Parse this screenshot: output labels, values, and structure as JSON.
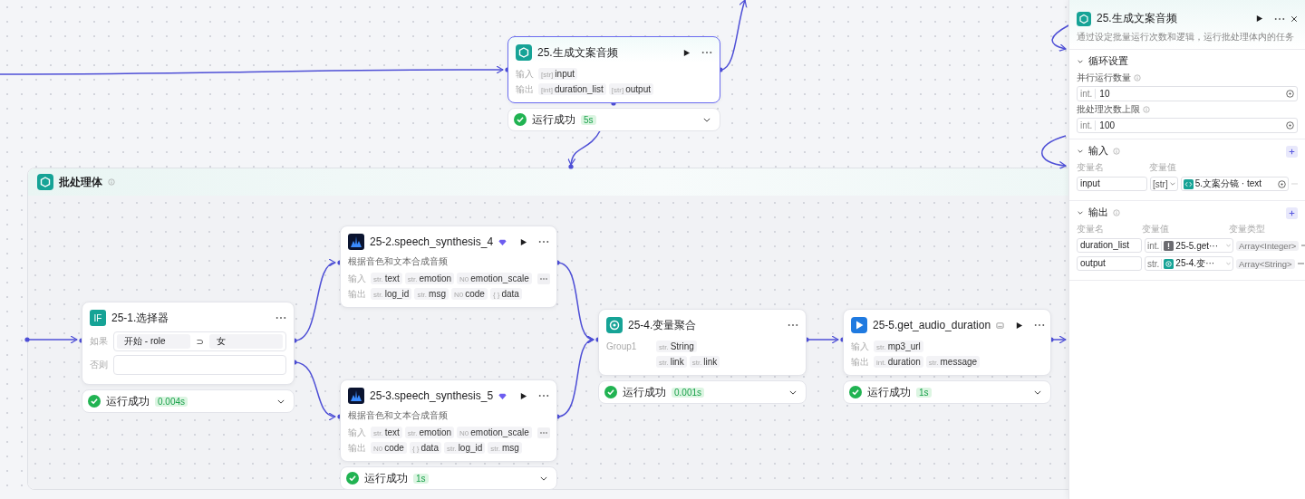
{
  "nodes": [
    {
      "kind": "plugin",
      "title": "25.生成文案音频",
      "selected": true,
      "runnable": true,
      "rows": [
        {
          "label": "输入",
          "tags": [
            {
              "type": "[str]",
              "name": "input"
            }
          ]
        },
        {
          "label": "输出",
          "tags": [
            {
              "type": "[int]",
              "name": "duration_list"
            },
            {
              "type": "[str]",
              "name": "output"
            }
          ]
        }
      ],
      "status": {
        "ok": true,
        "text": "运行成功",
        "time": "5s"
      }
    },
    {
      "kind": "selector",
      "badge_text": "IF",
      "title": "25-1.选择器",
      "selected": false,
      "if_label": "如果",
      "condition": {
        "left": "开始  -  role",
        "op": "⊃",
        "right": "女"
      },
      "else_label": "否则",
      "status": {
        "ok": true,
        "text": "运行成功",
        "time": "0.004s"
      }
    },
    {
      "kind": "plugin",
      "title": "25-2.speech_synthesis_4",
      "selected": false,
      "runnable": true,
      "description": "根据音色和文本合成音频",
      "rows": [
        {
          "label": "输入",
          "more": true,
          "tags": [
            {
              "type": "str.",
              "name": "text"
            },
            {
              "type": "str.",
              "name": "emotion"
            },
            {
              "type": "N0",
              "name": "emotion_scale"
            }
          ]
        },
        {
          "label": "输出",
          "tags": [
            {
              "type": "str.",
              "name": "log_id"
            },
            {
              "type": "str.",
              "name": "msg"
            },
            {
              "type": "N0",
              "name": "code"
            },
            {
              "type": "{ }",
              "name": "data"
            }
          ]
        }
      ]
    },
    {
      "kind": "plugin",
      "title": "25-3.speech_synthesis_5",
      "selected": false,
      "runnable": true,
      "description": "根据音色和文本合成音频",
      "rows": [
        {
          "label": "输入",
          "more": true,
          "tags": [
            {
              "type": "str.",
              "name": "text"
            },
            {
              "type": "str.",
              "name": "emotion"
            },
            {
              "type": "N0",
              "name": "emotion_scale"
            }
          ]
        },
        {
          "label": "输出",
          "tags": [
            {
              "type": "N0",
              "name": "code"
            },
            {
              "type": "{ }",
              "name": "data"
            },
            {
              "type": "str.",
              "name": "log_id"
            },
            {
              "type": "str.",
              "name": "msg"
            }
          ]
        }
      ],
      "status": {
        "ok": true,
        "text": "运行成功",
        "time": "1s"
      }
    },
    {
      "kind": "plugin",
      "title": "25-4.变量聚合",
      "selected": false,
      "runnable": false,
      "rows": [
        {
          "label": "Group1",
          "tags": [
            {
              "type": "str.",
              "name": "String"
            }
          ]
        },
        {
          "tags": [
            {
              "type": "str.",
              "name": "link"
            },
            {
              "type": "str.",
              "name": "link"
            }
          ]
        }
      ],
      "status": {
        "ok": true,
        "text": "运行成功",
        "time": "0.001s"
      }
    },
    {
      "kind": "plugin",
      "title": "25-5.get_audio_duration",
      "selected": false,
      "runnable": true,
      "rows": [
        {
          "label": "输入",
          "tags": [
            {
              "type": "str.",
              "name": "mp3_url"
            }
          ]
        },
        {
          "label": "输出",
          "tags": [
            {
              "type": "int.",
              "name": "duration"
            },
            {
              "type": "str.",
              "name": "message"
            }
          ]
        }
      ],
      "status": {
        "ok": true,
        "text": "运行成功",
        "time": "1s"
      }
    }
  ],
  "group": {
    "title": "批处理体"
  },
  "side_panel": {
    "title": "25.生成文案音频",
    "description": "通过设定批量运行次数和逻辑，运行批处理体内的任务",
    "loop": {
      "heading": "循环设置",
      "expanded": true,
      "fields": [
        {
          "label": "并行运行数量",
          "type": "int.",
          "value": "10"
        },
        {
          "label": "批处理次数上限",
          "type": "int.",
          "value": "100"
        }
      ]
    },
    "inputs": {
      "heading": "输入",
      "expanded": true,
      "columns": [
        "变量名",
        "变量值"
      ],
      "rows": [
        {
          "name": "input",
          "type": "[str]",
          "ref": "5.文案分镜 · text"
        }
      ]
    },
    "outputs": {
      "heading": "输出",
      "expanded": true,
      "columns": [
        "变量名",
        "变量值",
        "变量类型"
      ],
      "rows": [
        {
          "name": "duration_list",
          "type": "int.",
          "ref": "25-5.get···",
          "vtype": "Array<Integer>"
        },
        {
          "name": "output",
          "type": "str.",
          "ref": "25-4.变···",
          "vtype": "Array<String>"
        }
      ]
    }
  }
}
